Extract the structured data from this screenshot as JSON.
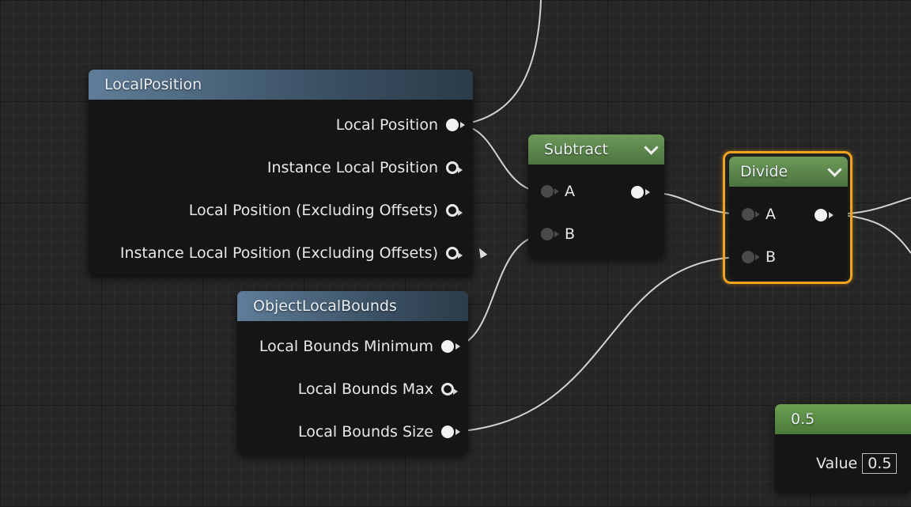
{
  "nodes": {
    "local_position": {
      "title": "LocalPosition",
      "outputs": [
        "Local Position",
        "Instance Local Position",
        "Local Position (Excluding Offsets)",
        "Instance Local Position (Excluding Offsets)"
      ]
    },
    "object_local_bounds": {
      "title": "ObjectLocalBounds",
      "outputs": [
        "Local Bounds Minimum",
        "Local Bounds Max",
        "Local Bounds Size"
      ]
    },
    "subtract": {
      "title": "Subtract",
      "input_a": "A",
      "input_b": "B"
    },
    "divide": {
      "title": "Divide",
      "input_a": "A",
      "input_b": "B"
    },
    "constant": {
      "title": "0.5",
      "value_label": "Value",
      "value": "0.5"
    }
  },
  "colors": {
    "blue_header": "#4a6680",
    "green_header": "#5a8848",
    "selection_outline": "#f0a31c",
    "wire": "#d8d8d8"
  }
}
